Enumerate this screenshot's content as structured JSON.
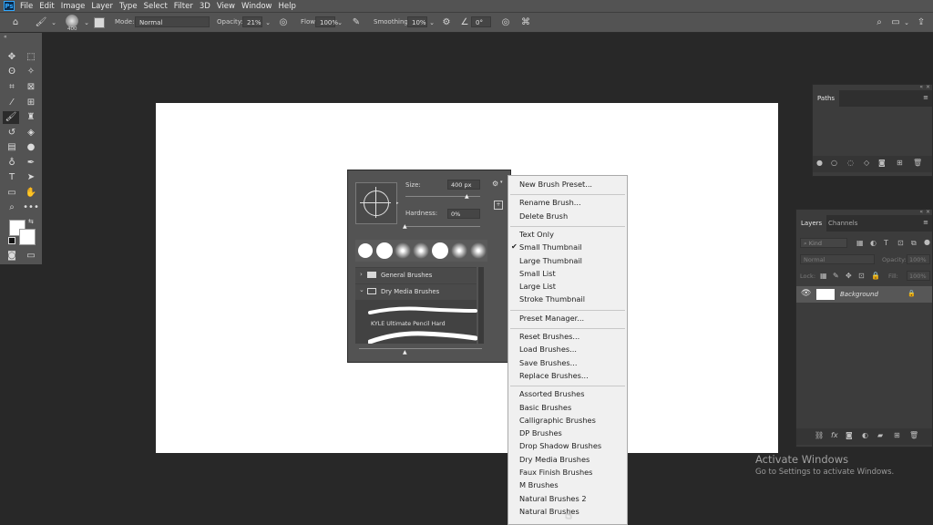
{
  "menubar": {
    "app_icon": "Ps",
    "items": [
      "File",
      "Edit",
      "Image",
      "Layer",
      "Type",
      "Select",
      "Filter",
      "3D",
      "View",
      "Window",
      "Help"
    ]
  },
  "options": {
    "brush_size": "400",
    "mode_label": "Mode:",
    "mode_value": "Normal",
    "opacity_label": "Opacity:",
    "opacity_value": "21%",
    "flow_label": "Flow:",
    "flow_value": "100%",
    "smoothing_label": "Smoothing:",
    "smoothing_value": "10%",
    "angle_value": "0°"
  },
  "brush_panel": {
    "size_label": "Size:",
    "size_value": "400 px",
    "hardness_label": "Hardness:",
    "hardness_value": "0%",
    "folders": [
      {
        "label": "General Brushes"
      },
      {
        "label": "Dry Media Brushes"
      }
    ],
    "brush_name": "KYLE Ultimate Pencil Hard"
  },
  "flyout": {
    "groups": [
      [
        "New Brush Preset..."
      ],
      [
        "Rename Brush...",
        "Delete Brush"
      ],
      [
        "Text Only",
        "Small Thumbnail",
        "Large Thumbnail",
        "Small List",
        "Large List",
        "Stroke Thumbnail"
      ],
      [
        "Preset Manager..."
      ],
      [
        "Reset Brushes...",
        "Load Brushes...",
        "Save Brushes...",
        "Replace Brushes..."
      ],
      [
        "Assorted Brushes",
        "Basic Brushes",
        "Calligraphic Brushes",
        "DP Brushes",
        "Drop Shadow Brushes",
        "Dry Media Brushes",
        "Faux Finish Brushes",
        "M Brushes",
        "Natural Brushes 2",
        "Natural Brushes"
      ]
    ],
    "checked": "Small Thumbnail"
  },
  "paths_panel": {
    "tab": "Paths"
  },
  "layers_panel": {
    "tab_layers": "Layers",
    "tab_channels": "Channels",
    "kind_placeholder": "Kind",
    "blend_mode": "Normal",
    "opacity_label": "Opacity:",
    "opacity_value": "100%",
    "lock_label": "Lock:",
    "fill_label": "Fill:",
    "fill_value": "100%",
    "layer_name": "Background"
  },
  "watermark": {
    "title": "Activate Windows",
    "subtitle": "Go to Settings to activate Windows."
  },
  "colors": {
    "workspace": "#282828",
    "chrome": "#535353",
    "panel": "#3c3c3c",
    "menu_bg": "#f0f0f0",
    "accent": "#31a8ff"
  }
}
